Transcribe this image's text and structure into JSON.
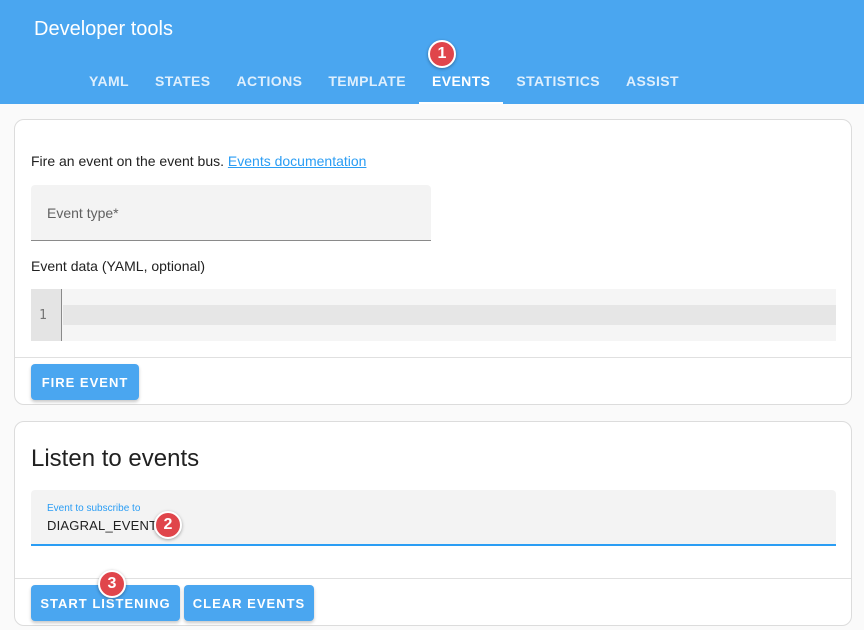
{
  "header": {
    "title": "Developer tools",
    "tabs": [
      {
        "label": "YAML"
      },
      {
        "label": "STATES"
      },
      {
        "label": "ACTIONS"
      },
      {
        "label": "TEMPLATE"
      },
      {
        "label": "EVENTS",
        "active": true
      },
      {
        "label": "STATISTICS"
      },
      {
        "label": "ASSIST"
      }
    ]
  },
  "fire_event": {
    "description": "Fire an event on the event bus.",
    "docs_link": "Events documentation",
    "event_type_label": "Event type*",
    "event_data_label": "Event data (YAML, optional)",
    "editor_line_number": "1",
    "button_label": "FIRE EVENT"
  },
  "listen": {
    "title": "Listen to events",
    "subscribe_label": "Event to subscribe to",
    "subscribe_value": "DIAGRAL_EVENT",
    "start_button": "START LISTENING",
    "clear_button": "CLEAR EVENTS"
  },
  "annotations": {
    "step1": "1",
    "step2": "2",
    "step3": "3"
  },
  "colors": {
    "accent": "#4aa6f0",
    "link": "#2a9df4",
    "badge": "#e0454b"
  }
}
